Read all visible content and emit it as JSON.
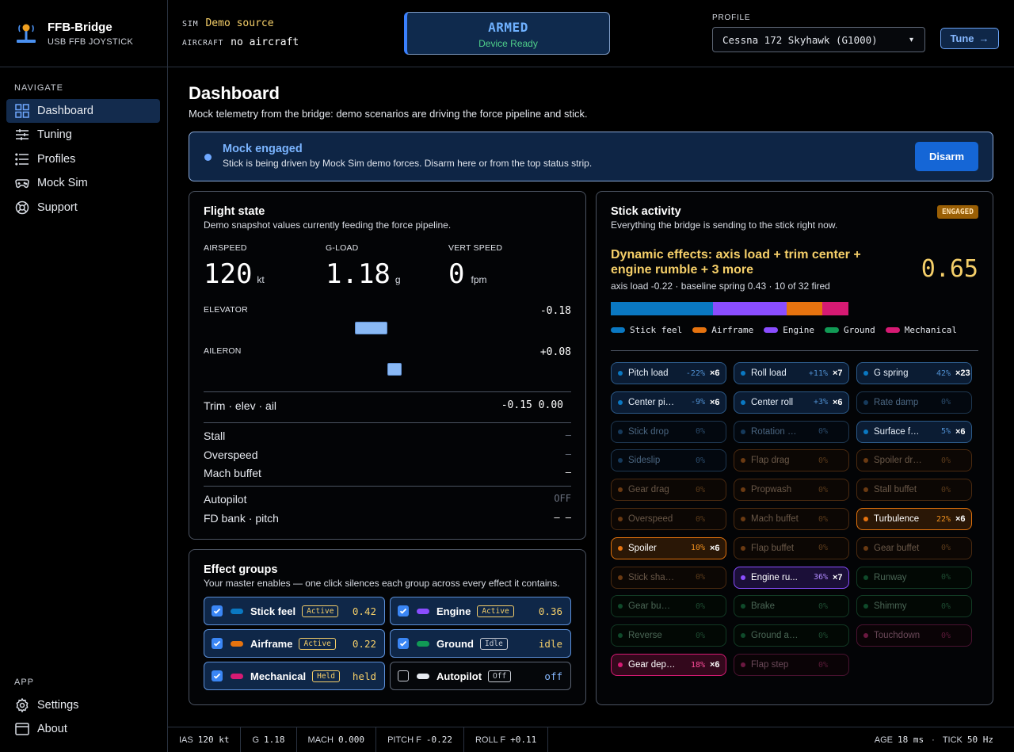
{
  "brand": {
    "name": "FFB-Bridge",
    "subtitle": "USB FFB JOYSTICK"
  },
  "nav": {
    "heading": "NAVIGATE",
    "items": [
      {
        "label": "Dashboard"
      },
      {
        "label": "Tuning"
      },
      {
        "label": "Profiles"
      },
      {
        "label": "Mock Sim"
      },
      {
        "label": "Support"
      }
    ],
    "app_heading": "APP",
    "app_items": [
      {
        "label": "Settings"
      },
      {
        "label": "About"
      }
    ]
  },
  "header": {
    "sim_label": "SIM",
    "sim_value": "Demo source",
    "aircraft_label": "AIRCRAFT",
    "aircraft_value": "no aircraft",
    "armed": "ARMED",
    "device": "Device Ready",
    "profile_label": "PROFILE",
    "profile_value": "Cessna 172 Skyhawk (G1000)",
    "profile_caret": "▾",
    "tune": "Tune",
    "tune_arrow": "→"
  },
  "page": {
    "title": "Dashboard",
    "subtitle": "Mock telemetry from the bridge: demo scenarios are driving the force pipeline and stick."
  },
  "banner": {
    "title": "Mock engaged",
    "text": "Stick is being driven by Mock Sim demo forces. Disarm here or from the top status strip.",
    "button": "Disarm"
  },
  "flight": {
    "title": "Flight state",
    "subtitle": "Demo snapshot values currently feeding the force pipeline.",
    "airspeed_label": "AIRSPEED",
    "airspeed": "120",
    "airspeed_unit": "kt",
    "gload_label": "G-LOAD",
    "gload": "1.18",
    "gload_unit": "g",
    "vs_label": "VERT SPEED",
    "vs": "0",
    "vs_unit": "fpm",
    "elevator_label": "ELEVATOR",
    "elevator": "-0.18",
    "elevator_value": -0.18,
    "aileron_label": "AILERON",
    "aileron": "+0.08",
    "aileron_value": 0.08,
    "trim_label": "Trim · elev · ail",
    "trim_value": "-0.15 0.00",
    "stall_label": "Stall",
    "stall": "—",
    "overspeed_label": "Overspeed",
    "overspeed": "—",
    "mach_label": "Mach buffet",
    "mach": "—",
    "ap_label": "Autopilot",
    "ap": "OFF",
    "fd_label": "FD bank · pitch",
    "fd": "— —"
  },
  "groups": {
    "title": "Effect groups",
    "subtitle": "Your master enables — one click silences each group across every effect it contains.",
    "items": [
      {
        "name": "Stick feel",
        "badge": "Active",
        "value": "0.42",
        "color": "#0a78c2",
        "on": true
      },
      {
        "name": "Engine",
        "badge": "Active",
        "value": "0.36",
        "color": "#8a4dff",
        "on": true
      },
      {
        "name": "Airframe",
        "badge": "Active",
        "value": "0.22",
        "color": "#e6730f",
        "on": true
      },
      {
        "name": "Ground",
        "badge": "Idle",
        "value": "idle",
        "color": "#119a55",
        "on": true
      },
      {
        "name": "Mechanical",
        "badge": "Held",
        "value": "held",
        "color": "#d61a73",
        "on": true
      },
      {
        "name": "Autopilot",
        "badge": "Off",
        "value": "off",
        "color": "#e6eaf0",
        "on": false
      }
    ]
  },
  "stick": {
    "title": "Stick activity",
    "subtitle": "Everything the bridge is sending to the stick right now.",
    "badge": "ENGAGED",
    "headline": "Dynamic effects: axis load + trim center + engine rumble + 3 more",
    "value": "0.65",
    "detail": "axis load -0.22 · baseline spring 0.43 · 10 of 32 fired",
    "mix": [
      {
        "name": "Stick feel",
        "share": 43,
        "color": "#0a78c2"
      },
      {
        "name": "Engine",
        "share": 31,
        "color": "#8a4dff"
      },
      {
        "name": "Airframe",
        "share": 15,
        "color": "#e6730f"
      },
      {
        "name": "Mechanical",
        "share": 11,
        "color": "#d61a73"
      }
    ],
    "legend": [
      {
        "name": "Stick feel",
        "color": "#0a78c2"
      },
      {
        "name": "Airframe",
        "color": "#e6730f"
      },
      {
        "name": "Engine",
        "color": "#8a4dff"
      },
      {
        "name": "Ground",
        "color": "#119a55"
      },
      {
        "name": "Mechanical",
        "color": "#d61a73"
      }
    ],
    "effects": [
      {
        "name": "Pitch load",
        "pct": "-22%",
        "count": "×6",
        "group": "stick",
        "active": true
      },
      {
        "name": "Roll load",
        "pct": "+11%",
        "count": "×7",
        "group": "stick",
        "active": true
      },
      {
        "name": "G spring",
        "pct": "42%",
        "count": "×23",
        "group": "stick",
        "active": true
      },
      {
        "name": "Center pitch",
        "pct": "-9%",
        "count": "×6",
        "group": "stick",
        "active": true
      },
      {
        "name": "Center roll",
        "pct": "+3%",
        "count": "×6",
        "group": "stick",
        "active": true
      },
      {
        "name": "Rate damp",
        "pct": "0%",
        "count": "",
        "group": "stick",
        "active": false
      },
      {
        "name": "Stick drop",
        "pct": "0%",
        "count": "",
        "group": "stick",
        "active": false
      },
      {
        "name": "Rotation kick",
        "pct": "0%",
        "count": "",
        "group": "stick",
        "active": false
      },
      {
        "name": "Surface foll...",
        "pct": "5%",
        "count": "×6",
        "group": "stick",
        "active": true
      },
      {
        "name": "Sideslip",
        "pct": "0%",
        "count": "",
        "group": "stick",
        "active": false
      },
      {
        "name": "Flap drag",
        "pct": "0%",
        "count": "",
        "group": "air",
        "active": false
      },
      {
        "name": "Spoiler drag",
        "pct": "0%",
        "count": "",
        "group": "air",
        "active": false
      },
      {
        "name": "Gear drag",
        "pct": "0%",
        "count": "",
        "group": "air",
        "active": false
      },
      {
        "name": "Propwash",
        "pct": "0%",
        "count": "",
        "group": "air",
        "active": false
      },
      {
        "name": "Stall buffet",
        "pct": "0%",
        "count": "",
        "group": "air",
        "active": false
      },
      {
        "name": "Overspeed",
        "pct": "0%",
        "count": "",
        "group": "air",
        "active": false
      },
      {
        "name": "Mach buffet",
        "pct": "0%",
        "count": "",
        "group": "air",
        "active": false
      },
      {
        "name": "Turbulence",
        "pct": "22%",
        "count": "×6",
        "group": "air",
        "active": true
      },
      {
        "name": "Spoiler",
        "pct": "10%",
        "count": "×6",
        "group": "air",
        "active": true
      },
      {
        "name": "Flap buffet",
        "pct": "0%",
        "count": "",
        "group": "air",
        "active": false
      },
      {
        "name": "Gear buffet",
        "pct": "0%",
        "count": "",
        "group": "air",
        "active": false
      },
      {
        "name": "Stick shaker",
        "pct": "0%",
        "count": "",
        "group": "air",
        "active": false
      },
      {
        "name": "Engine ru...",
        "pct": "36%",
        "count": "×7",
        "group": "engine",
        "active": true
      },
      {
        "name": "Runway",
        "pct": "0%",
        "count": "",
        "group": "ground",
        "active": false
      },
      {
        "name": "Gear bumps",
        "pct": "0%",
        "count": "",
        "group": "ground",
        "active": false
      },
      {
        "name": "Brake",
        "pct": "0%",
        "count": "",
        "group": "ground",
        "active": false
      },
      {
        "name": "Shimmy",
        "pct": "0%",
        "count": "",
        "group": "ground",
        "active": false
      },
      {
        "name": "Reverse",
        "pct": "0%",
        "count": "",
        "group": "ground",
        "active": false
      },
      {
        "name": "Ground accel",
        "pct": "0%",
        "count": "",
        "group": "ground",
        "active": false
      },
      {
        "name": "Touchdown",
        "pct": "0%",
        "count": "",
        "group": "mech",
        "active": false
      },
      {
        "name": "Gear deploy",
        "pct": "18%",
        "count": "×6",
        "group": "mech",
        "active": true
      },
      {
        "name": "Flap step",
        "pct": "0%",
        "count": "",
        "group": "mech",
        "active": false
      }
    ]
  },
  "statusbar": {
    "ias_label": "IAS",
    "ias": "120 kt",
    "g_label": "G",
    "g": "1.18",
    "mach_label": "MACH",
    "mach": "0.000",
    "pitch_label": "PITCH F",
    "pitch": "-0.22",
    "roll_label": "ROLL F",
    "roll": "+0.11",
    "age_label": "AGE",
    "age": "18 ms",
    "sep": "·",
    "tick_label": "TICK",
    "tick": "50 Hz"
  }
}
